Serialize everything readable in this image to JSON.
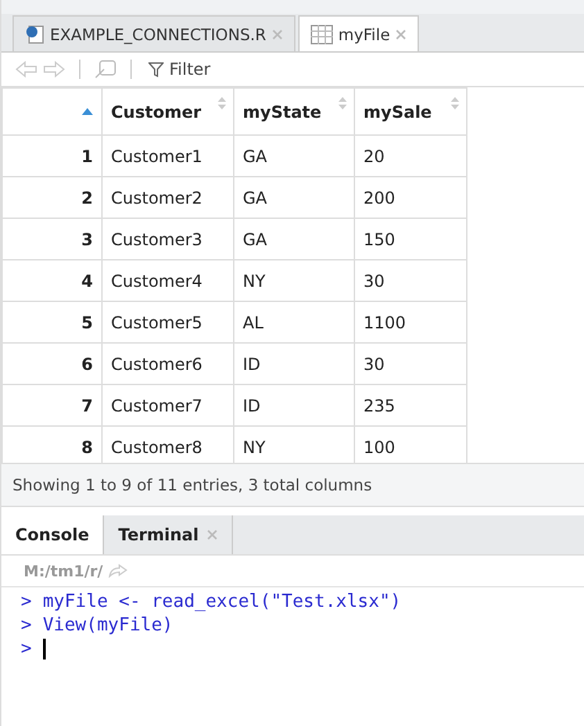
{
  "editor_tabs": [
    {
      "label": "EXAMPLE_CONNECTIONS.R",
      "kind": "script",
      "selected": false
    },
    {
      "label": "myFile",
      "kind": "table",
      "selected": true
    }
  ],
  "toolbar": {
    "filter_label": "Filter"
  },
  "table": {
    "columns": [
      "Customer",
      "myState",
      "mySale"
    ],
    "rows": [
      {
        "index": "1",
        "cells": [
          "Customer1",
          "GA",
          "20"
        ]
      },
      {
        "index": "2",
        "cells": [
          "Customer2",
          "GA",
          "200"
        ]
      },
      {
        "index": "3",
        "cells": [
          "Customer3",
          "GA",
          "150"
        ]
      },
      {
        "index": "4",
        "cells": [
          "Customer4",
          "NY",
          "30"
        ]
      },
      {
        "index": "5",
        "cells": [
          "Customer5",
          "AL",
          "1100"
        ]
      },
      {
        "index": "6",
        "cells": [
          "Customer6",
          "ID",
          "30"
        ]
      },
      {
        "index": "7",
        "cells": [
          "Customer7",
          "ID",
          "235"
        ]
      },
      {
        "index": "8",
        "cells": [
          "Customer8",
          "NY",
          "100"
        ]
      }
    ]
  },
  "status_bar": "Showing 1 to 9 of 11 entries, 3 total columns",
  "console_tabs": [
    {
      "label": "Console",
      "closable": false,
      "selected": true
    },
    {
      "label": "Terminal",
      "closable": true,
      "selected": false
    }
  ],
  "console": {
    "path": "M:/tm1/r/",
    "lines": [
      {
        "kind": "command",
        "prompt": ">",
        "code": "myFile <- read_excel(\"Test.xlsx\")"
      },
      {
        "kind": "command",
        "prompt": ">",
        "code": "View(myFile)"
      },
      {
        "kind": "input",
        "prompt": ">"
      }
    ]
  }
}
